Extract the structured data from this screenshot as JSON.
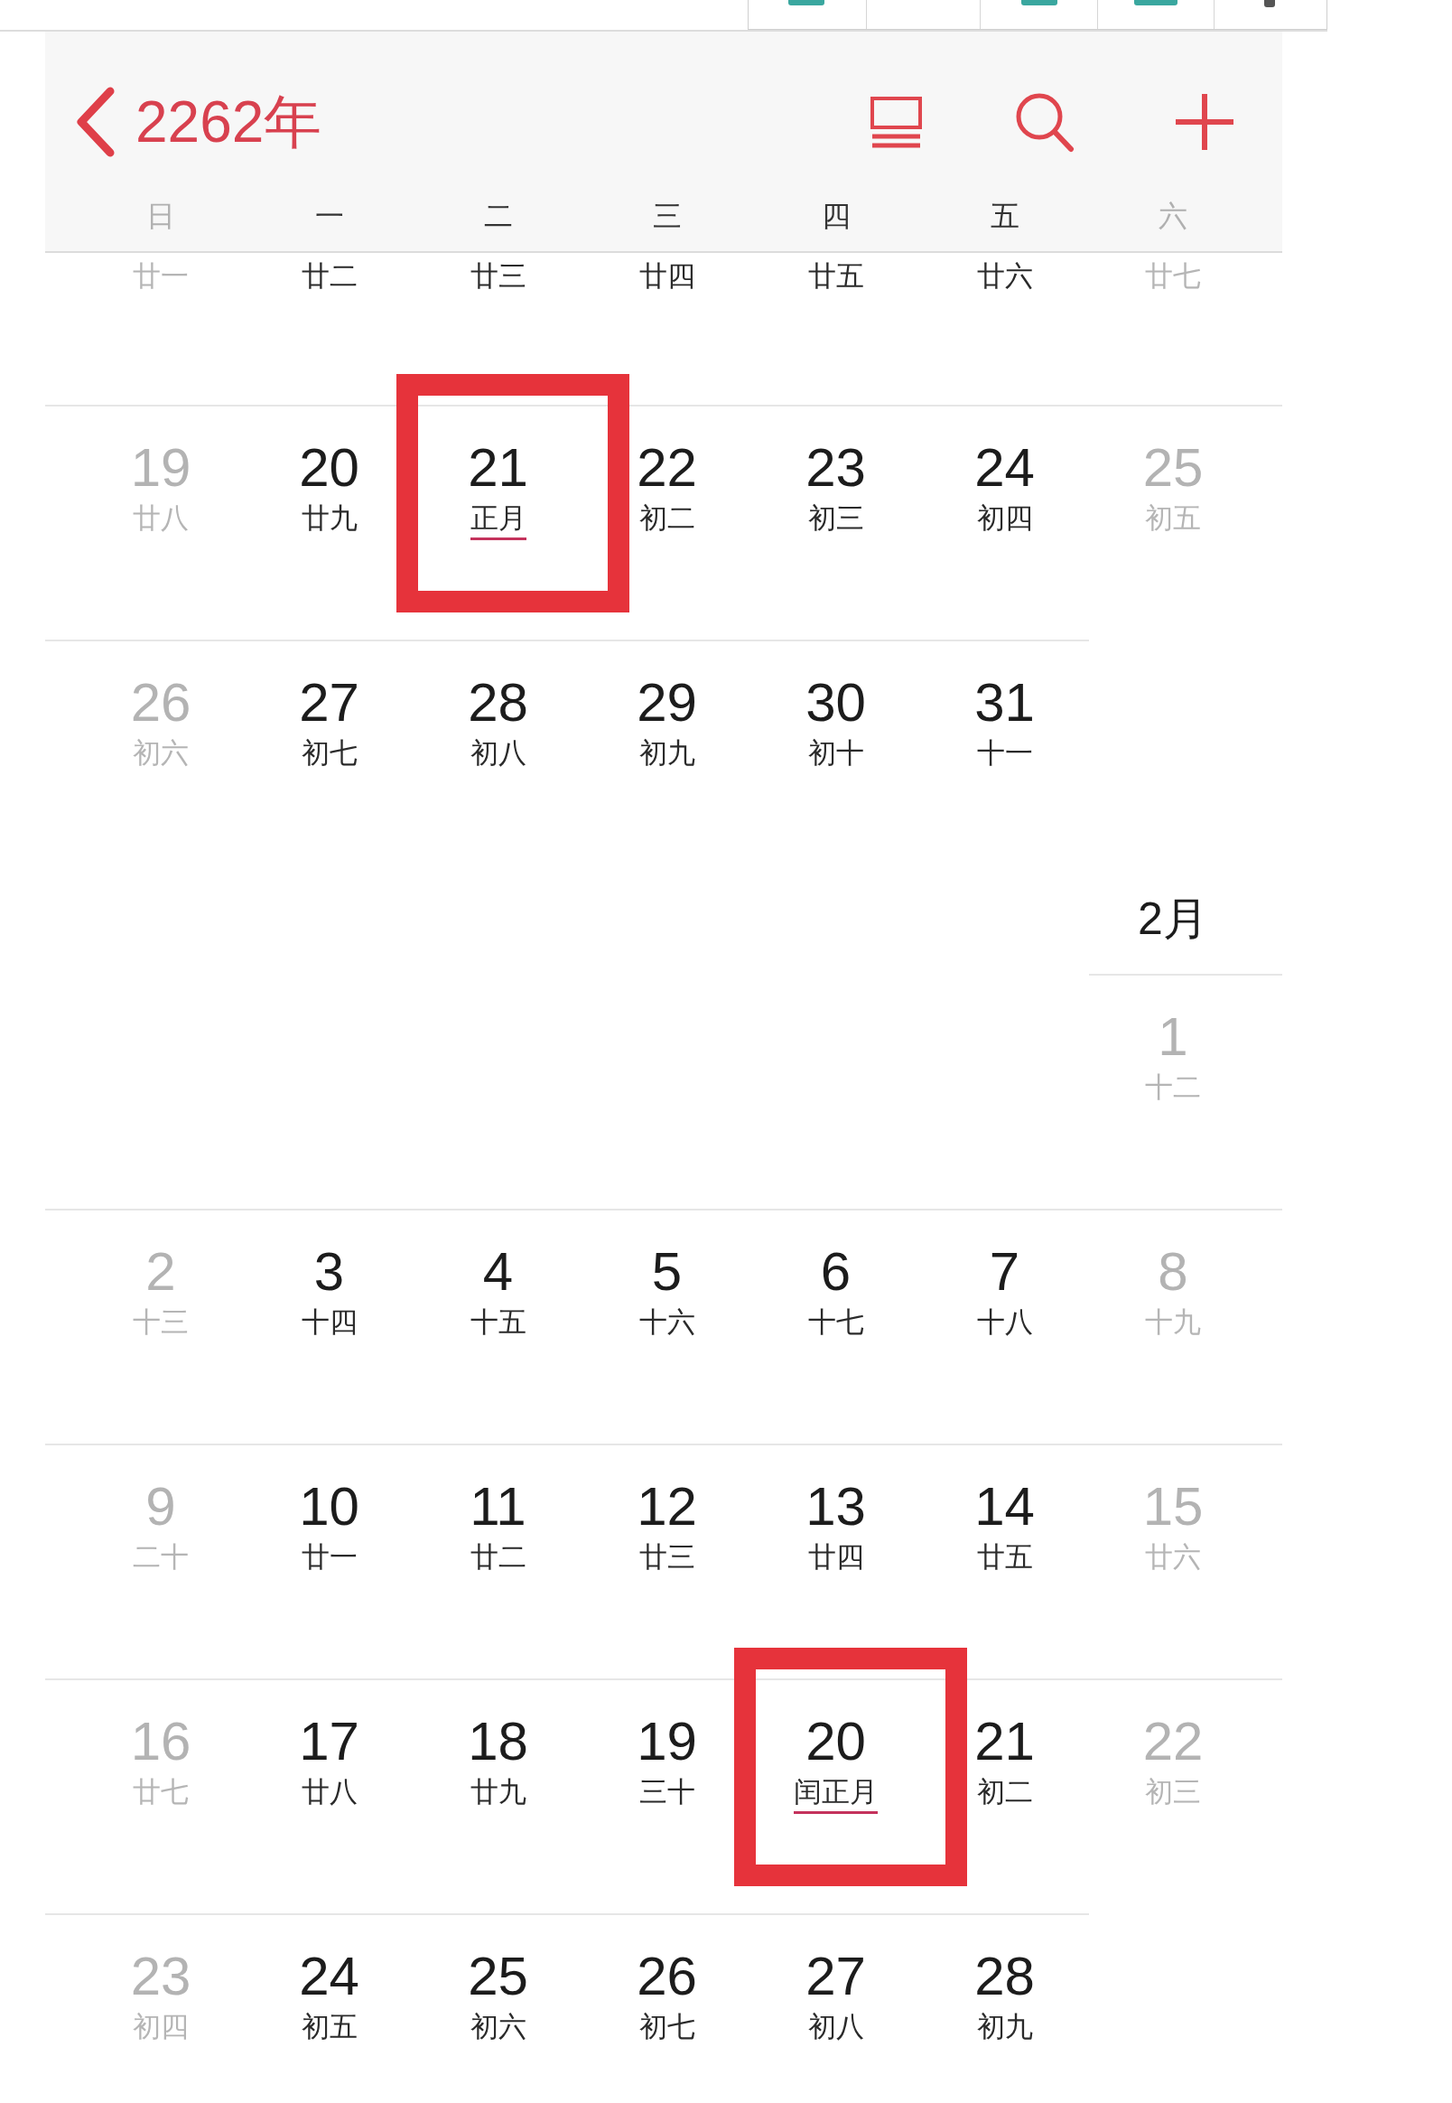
{
  "header": {
    "title": "2262年"
  },
  "weekdays": [
    {
      "label": "日",
      "dimmed": true
    },
    {
      "label": "一",
      "dimmed": false
    },
    {
      "label": "二",
      "dimmed": false
    },
    {
      "label": "三",
      "dimmed": false
    },
    {
      "label": "四",
      "dimmed": false
    },
    {
      "label": "五",
      "dimmed": false
    },
    {
      "label": "六",
      "dimmed": true
    }
  ],
  "previous_week_lunar": [
    {
      "lunar": "廿一",
      "dimmed": true
    },
    {
      "lunar": "廿二",
      "dimmed": false
    },
    {
      "lunar": "廿三",
      "dimmed": false
    },
    {
      "lunar": "廿四",
      "dimmed": false
    },
    {
      "lunar": "廿五",
      "dimmed": false
    },
    {
      "lunar": "廿六",
      "dimmed": false
    },
    {
      "lunar": "廿七",
      "dimmed": true
    }
  ],
  "months": [
    {
      "weeks": [
        {
          "days": [
            {
              "day": "19",
              "lunar": "廿八",
              "dimmed": true,
              "highlighted": false,
              "marked": false
            },
            {
              "day": "20",
              "lunar": "廿九",
              "dimmed": false,
              "highlighted": false,
              "marked": false
            },
            {
              "day": "21",
              "lunar": "正月",
              "dimmed": false,
              "highlighted": true,
              "marked": true
            },
            {
              "day": "22",
              "lunar": "初二",
              "dimmed": false,
              "highlighted": false,
              "marked": false
            },
            {
              "day": "23",
              "lunar": "初三",
              "dimmed": false,
              "highlighted": false,
              "marked": false
            },
            {
              "day": "24",
              "lunar": "初四",
              "dimmed": false,
              "highlighted": false,
              "marked": false
            },
            {
              "day": "25",
              "lunar": "初五",
              "dimmed": true,
              "highlighted": false,
              "marked": false
            }
          ]
        },
        {
          "days": [
            {
              "day": "26",
              "lunar": "初六",
              "dimmed": true,
              "highlighted": false,
              "marked": false
            },
            {
              "day": "27",
              "lunar": "初七",
              "dimmed": false,
              "highlighted": false,
              "marked": false
            },
            {
              "day": "28",
              "lunar": "初八",
              "dimmed": false,
              "highlighted": false,
              "marked": false
            },
            {
              "day": "29",
              "lunar": "初九",
              "dimmed": false,
              "highlighted": false,
              "marked": false
            },
            {
              "day": "30",
              "lunar": "初十",
              "dimmed": false,
              "highlighted": false,
              "marked": false
            },
            {
              "day": "31",
              "lunar": "十一",
              "dimmed": false,
              "highlighted": false,
              "marked": false
            }
          ]
        }
      ]
    },
    {
      "label": "2月",
      "weeks": [
        {
          "days": [
            {
              "day": "1",
              "lunar": "十二",
              "dimmed": true,
              "highlighted": false,
              "marked": false
            }
          ]
        },
        {
          "days": [
            {
              "day": "2",
              "lunar": "十三",
              "dimmed": true,
              "highlighted": false,
              "marked": false
            },
            {
              "day": "3",
              "lunar": "十四",
              "dimmed": false,
              "highlighted": false,
              "marked": false
            },
            {
              "day": "4",
              "lunar": "十五",
              "dimmed": false,
              "highlighted": false,
              "marked": false
            },
            {
              "day": "5",
              "lunar": "十六",
              "dimmed": false,
              "highlighted": false,
              "marked": false
            },
            {
              "day": "6",
              "lunar": "十七",
              "dimmed": false,
              "highlighted": false,
              "marked": false
            },
            {
              "day": "7",
              "lunar": "十八",
              "dimmed": false,
              "highlighted": false,
              "marked": false
            },
            {
              "day": "8",
              "lunar": "十九",
              "dimmed": true,
              "highlighted": false,
              "marked": false
            }
          ]
        },
        {
          "days": [
            {
              "day": "9",
              "lunar": "二十",
              "dimmed": true,
              "highlighted": false,
              "marked": false
            },
            {
              "day": "10",
              "lunar": "廿一",
              "dimmed": false,
              "highlighted": false,
              "marked": false
            },
            {
              "day": "11",
              "lunar": "廿二",
              "dimmed": false,
              "highlighted": false,
              "marked": false
            },
            {
              "day": "12",
              "lunar": "廿三",
              "dimmed": false,
              "highlighted": false,
              "marked": false
            },
            {
              "day": "13",
              "lunar": "廿四",
              "dimmed": false,
              "highlighted": false,
              "marked": false
            },
            {
              "day": "14",
              "lunar": "廿五",
              "dimmed": false,
              "highlighted": false,
              "marked": false
            },
            {
              "day": "15",
              "lunar": "廿六",
              "dimmed": true,
              "highlighted": false,
              "marked": false
            }
          ]
        },
        {
          "days": [
            {
              "day": "16",
              "lunar": "廿七",
              "dimmed": true,
              "highlighted": false,
              "marked": false
            },
            {
              "day": "17",
              "lunar": "廿八",
              "dimmed": false,
              "highlighted": false,
              "marked": false
            },
            {
              "day": "18",
              "lunar": "廿九",
              "dimmed": false,
              "highlighted": false,
              "marked": false
            },
            {
              "day": "19",
              "lunar": "三十",
              "dimmed": false,
              "highlighted": false,
              "marked": false
            },
            {
              "day": "20",
              "lunar": "闰正月",
              "dimmed": false,
              "highlighted": true,
              "marked": true
            },
            {
              "day": "21",
              "lunar": "初二",
              "dimmed": false,
              "highlighted": false,
              "marked": false
            },
            {
              "day": "22",
              "lunar": "初三",
              "dimmed": true,
              "highlighted": false,
              "marked": false
            }
          ]
        },
        {
          "days": [
            {
              "day": "23",
              "lunar": "初四",
              "dimmed": true,
              "highlighted": false,
              "marked": false
            },
            {
              "day": "24",
              "lunar": "初五",
              "dimmed": false,
              "highlighted": false,
              "marked": false
            },
            {
              "day": "25",
              "lunar": "初六",
              "dimmed": false,
              "highlighted": false,
              "marked": false
            },
            {
              "day": "26",
              "lunar": "初七",
              "dimmed": false,
              "highlighted": false,
              "marked": false
            },
            {
              "day": "27",
              "lunar": "初八",
              "dimmed": false,
              "highlighted": false,
              "marked": false
            },
            {
              "day": "28",
              "lunar": "初九",
              "dimmed": false,
              "highlighted": false,
              "marked": false
            }
          ]
        }
      ]
    }
  ]
}
